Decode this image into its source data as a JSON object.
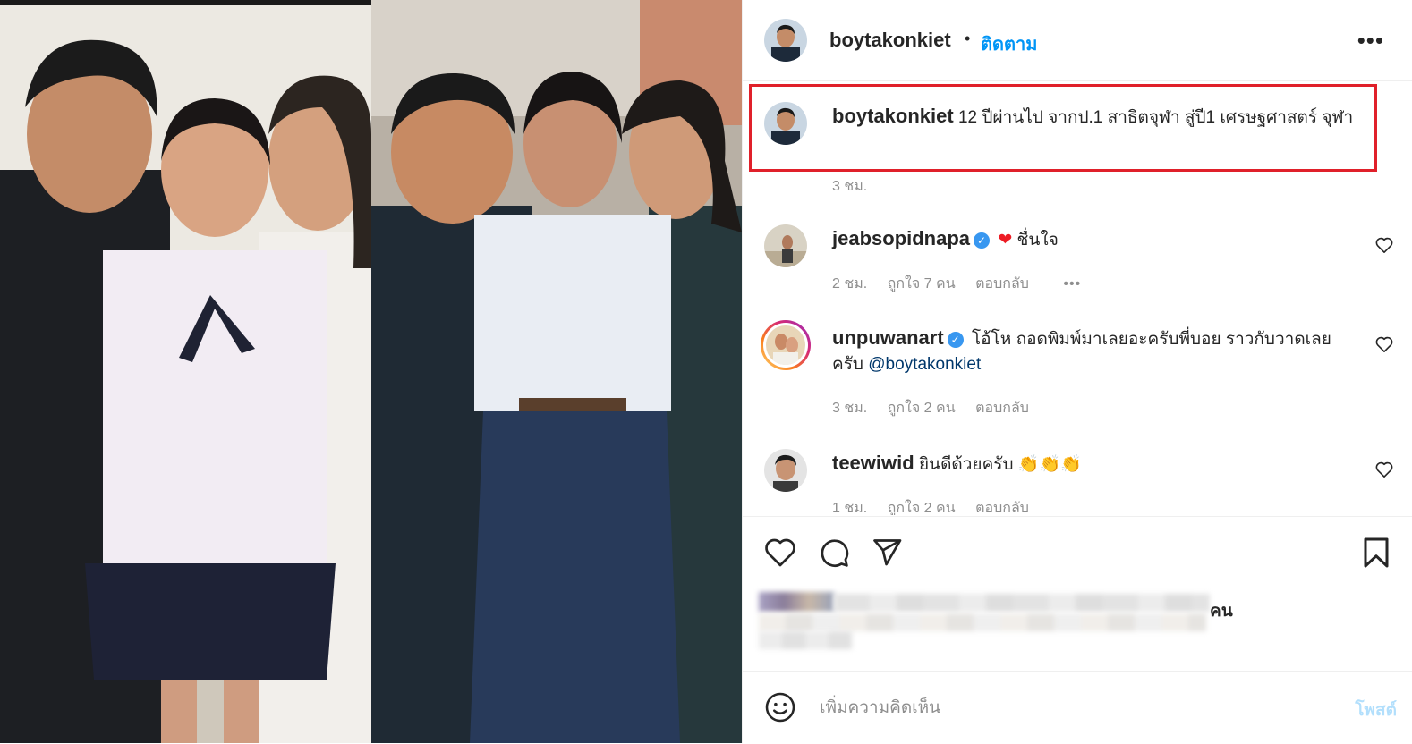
{
  "post": {
    "author": "boytakonkiet",
    "follow_label": "ติดตาม",
    "separator": "•",
    "more_label": "•••"
  },
  "caption": {
    "username": "boytakonkiet",
    "text": "12 ปีผ่านไป จากป.1 สาธิตจุฬา สู่ปี1 เศรษฐศาสตร์ จุฬา",
    "time": "3 ชม."
  },
  "comments": [
    {
      "username": "jeabsopidnapa",
      "verified": true,
      "text": "ชื่นใจ",
      "emoji": "❤",
      "time": "2 ชม.",
      "likes": "ถูกใจ 7 คน",
      "reply": "ตอบกลับ",
      "more": "•••"
    },
    {
      "username": "unpuwanart",
      "verified": true,
      "text": "โอ้โห ถอดพิมพ์มาเลยอะครับพี่บอย ราวกับวาดเลย ครับ",
      "mention": "@boytakonkiet",
      "time": "3 ชม.",
      "likes": "ถูกใจ 2 คน",
      "reply": "ตอบกลับ"
    },
    {
      "username": "teewiwid",
      "verified": false,
      "text": "ยินดีด้วยครับ",
      "emoji": "👏👏👏",
      "time": "1 ชม.",
      "likes": "ถูกใจ 2 คน",
      "reply": "ตอบกลับ"
    }
  ],
  "likes_suffix": "คน",
  "add_comment": {
    "placeholder": "เพิ่มความคิดเห็น",
    "post_label": "โพสต์"
  },
  "colors": {
    "link": "#0095f6",
    "highlight_box": "#e0202a",
    "muted": "#8e8e8e",
    "text": "#262626",
    "mention": "#00376b"
  },
  "icons": {
    "like": "heart-icon",
    "comment": "comment-bubble-icon",
    "share": "paper-plane-icon",
    "save": "bookmark-icon",
    "emoji": "smiley-icon",
    "more": "ellipsis-icon",
    "verified": "verified-badge-icon"
  }
}
